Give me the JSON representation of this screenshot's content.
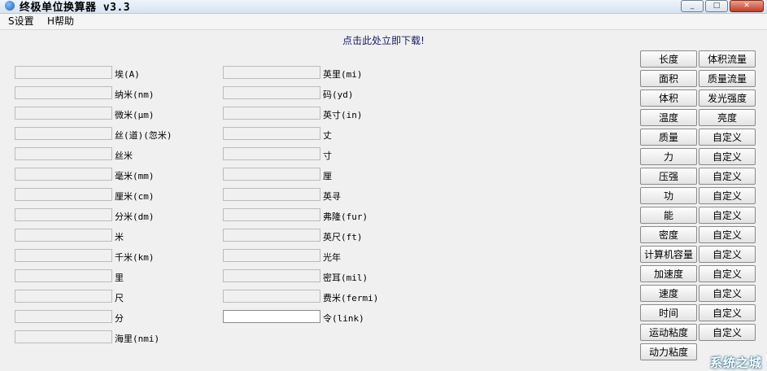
{
  "window": {
    "title": "终极单位换算器 v3.3",
    "buttons": [
      "_",
      "□",
      "✕"
    ]
  },
  "menu": [
    {
      "label": "S设置"
    },
    {
      "label": "H帮助"
    }
  ],
  "download_link": "点击此处立即下载!",
  "fields_left": [
    {
      "label": "埃(A)"
    },
    {
      "label": "纳米(nm)"
    },
    {
      "label": "微米(μm)"
    },
    {
      "label": "丝(道)(忽米)"
    },
    {
      "label": "丝米"
    },
    {
      "label": "毫米(mm)"
    },
    {
      "label": "厘米(cm)"
    },
    {
      "label": "分米(dm)"
    },
    {
      "label": "米"
    },
    {
      "label": "千米(km)"
    },
    {
      "label": "里"
    },
    {
      "label": "尺"
    },
    {
      "label": "分"
    },
    {
      "label": "海里(nmi)"
    }
  ],
  "fields_right": [
    {
      "label": "英里(mi)"
    },
    {
      "label": "码(yd)"
    },
    {
      "label": "英寸(in)"
    },
    {
      "label": "丈"
    },
    {
      "label": "寸"
    },
    {
      "label": "厘"
    },
    {
      "label": "英寻"
    },
    {
      "label": "弗隆(fur)"
    },
    {
      "label": "英尺(ft)"
    },
    {
      "label": "光年"
    },
    {
      "label": "密耳(mil)"
    },
    {
      "label": "费米(fermi)"
    },
    {
      "label": "令(link)"
    }
  ],
  "category_left": [
    "长度",
    "面积",
    "体积",
    "温度",
    "质量",
    "力",
    "压强",
    "功",
    "能",
    "密度",
    "计算机容量",
    "加速度",
    "速度",
    "时间",
    "运动粘度",
    "动力粘度"
  ],
  "category_right": [
    "体积流量",
    "质量流量",
    "发光强度",
    "亮度",
    "自定义",
    "自定义",
    "自定义",
    "自定义",
    "自定义",
    "自定义",
    "自定义",
    "自定义",
    "自定义",
    "自定义",
    "自定义"
  ],
  "watermark": "系统之城"
}
